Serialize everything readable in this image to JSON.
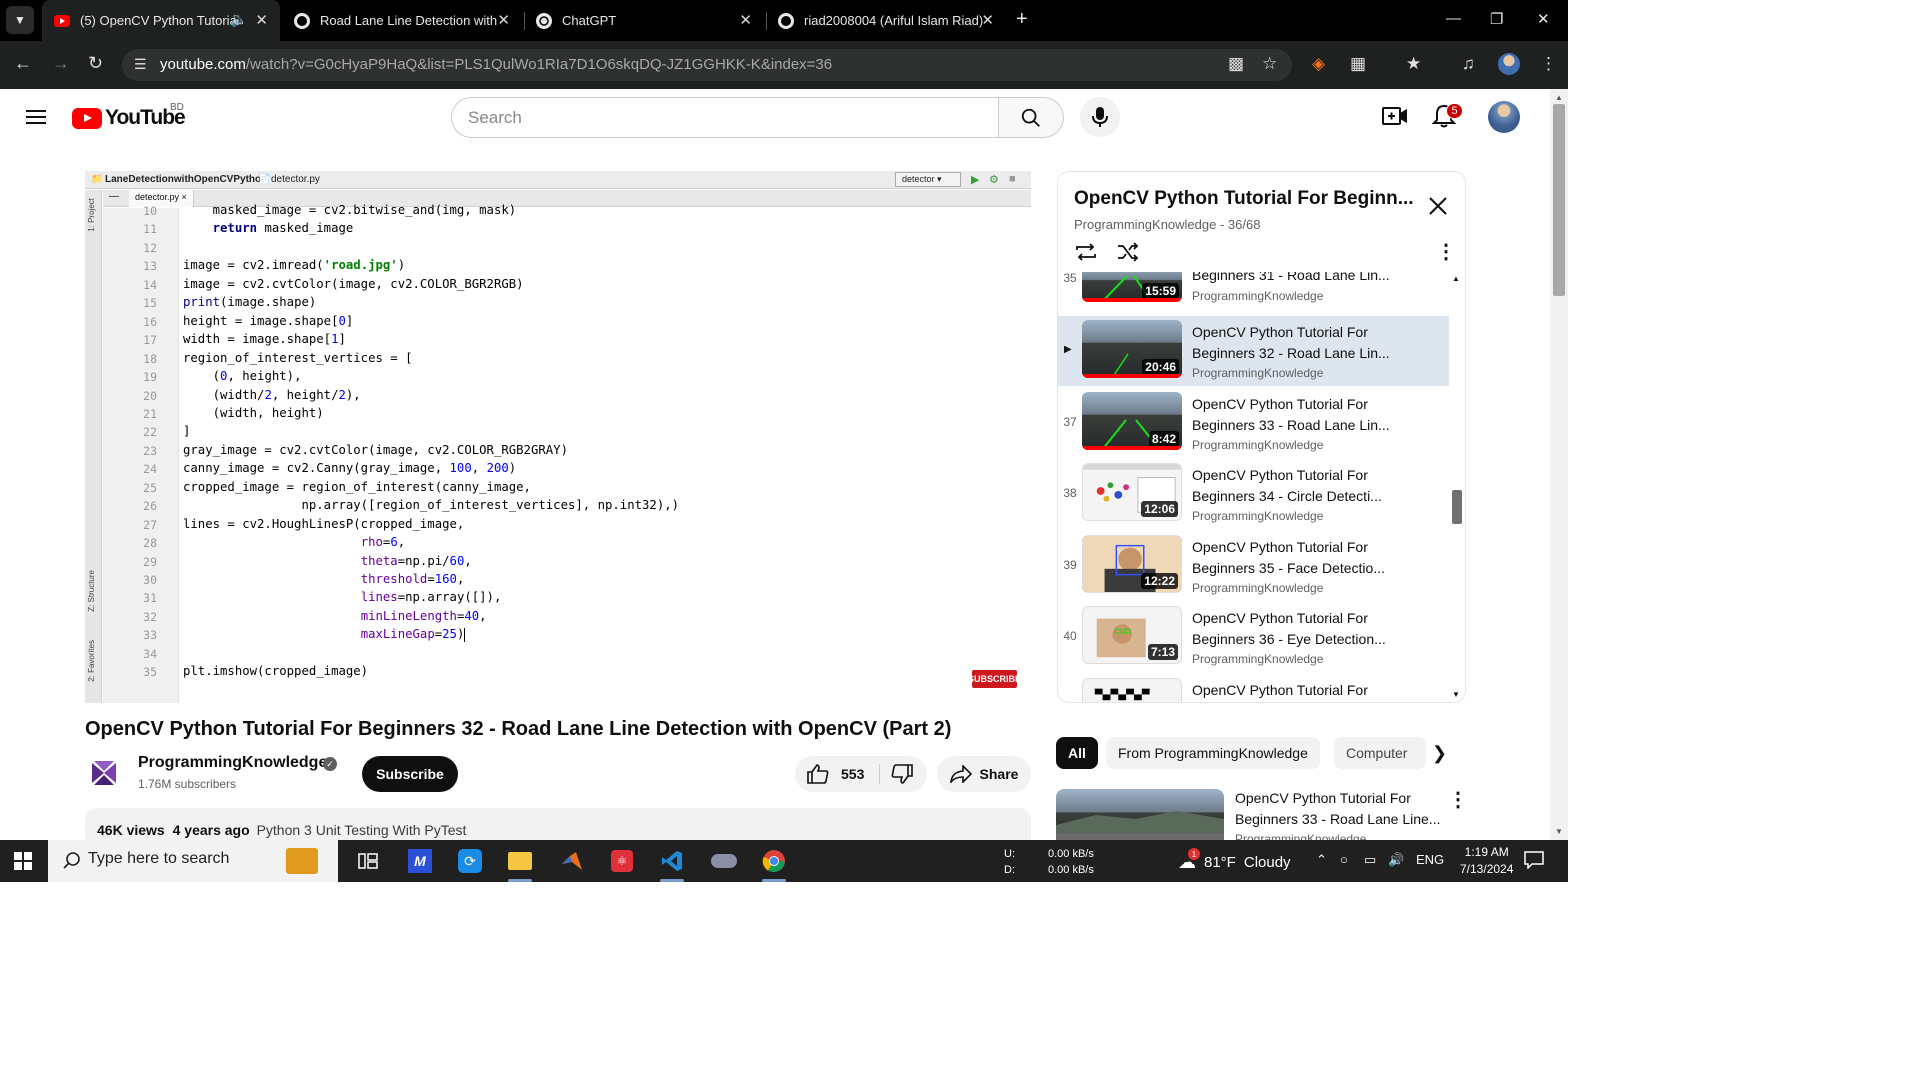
{
  "browser": {
    "tabs": [
      {
        "title": "(5) OpenCV Python Tutorial",
        "active": true,
        "icon": "youtube-icon"
      },
      {
        "title": "Road Lane Line Detection with",
        "active": false,
        "icon": "github-icon"
      },
      {
        "title": "ChatGPT",
        "active": false,
        "icon": "chatgpt-icon"
      },
      {
        "title": "riad2008004 (Ariful Islam Riad)",
        "active": false,
        "icon": "github-icon"
      }
    ],
    "url_host": "youtube.com",
    "url_path": "/watch?v=G0cHyaP9HaQ&list=PLS1QulWo1RIa7D1O6skqDQ-JZ1GGHKK-K&index=36"
  },
  "header": {
    "logo_text": "YouTube",
    "country": "BD",
    "search_placeholder": "Search",
    "notification_count": "5"
  },
  "ide": {
    "project": "LaneDetectionwithOpenCVPython",
    "file": "detector.py",
    "tab": "detector.py",
    "run_config": "detector",
    "side_project": "1: Project",
    "side_structure": "Z: Structure",
    "side_favorites": "2: Favorites",
    "watermark": "SUBSCRIBE",
    "lines": [
      {
        "n": "10",
        "code": "    masked_image = cv2.bitwise_and(img, mask)"
      },
      {
        "n": "11",
        "code": "    return masked_image"
      },
      {
        "n": "12",
        "code": ""
      },
      {
        "n": "13",
        "code": "image = cv2.imread('road.jpg')"
      },
      {
        "n": "14",
        "code": "image = cv2.cvtColor(image, cv2.COLOR_BGR2RGB)"
      },
      {
        "n": "15",
        "code": "print(image.shape)"
      },
      {
        "n": "16",
        "code": "height = image.shape[0]"
      },
      {
        "n": "17",
        "code": "width = image.shape[1]"
      },
      {
        "n": "18",
        "code": "region_of_interest_vertices = ["
      },
      {
        "n": "19",
        "code": "    (0, height),"
      },
      {
        "n": "20",
        "code": "    (width/2, height/2),"
      },
      {
        "n": "21",
        "code": "    (width, height)"
      },
      {
        "n": "22",
        "code": "]"
      },
      {
        "n": "23",
        "code": "gray_image = cv2.cvtColor(image, cv2.COLOR_RGB2GRAY)"
      },
      {
        "n": "24",
        "code": "canny_image = cv2.Canny(gray_image, 100, 200)"
      },
      {
        "n": "25",
        "code": "cropped_image = region_of_interest(canny_image,"
      },
      {
        "n": "26",
        "code": "                np.array([region_of_interest_vertices], np.int32),)"
      },
      {
        "n": "27",
        "code": "lines = cv2.HoughLinesP(cropped_image,"
      },
      {
        "n": "28",
        "code": "                        rho=6,"
      },
      {
        "n": "29",
        "code": "                        theta=np.pi/60,"
      },
      {
        "n": "30",
        "code": "                        threshold=160,"
      },
      {
        "n": "31",
        "code": "                        lines=np.array([]),"
      },
      {
        "n": "32",
        "code": "                        minLineLength=40,"
      },
      {
        "n": "33",
        "code": "                        maxLineGap=25)"
      },
      {
        "n": "34",
        "code": ""
      },
      {
        "n": "35",
        "code": "plt.imshow(cropped_image)"
      }
    ]
  },
  "video": {
    "title": "OpenCV Python Tutorial For Beginners 32 - Road Lane Line Detection with OpenCV (Part 2)",
    "channel": "ProgrammingKnowledge",
    "subscribers": "1.76M subscribers",
    "subscribe_label": "Subscribe",
    "likes": "553",
    "share_label": "Share",
    "views": "46K views",
    "age": "4 years ago",
    "description_tag": "Python 3 Unit Testing With PyTest"
  },
  "playlist": {
    "title": "OpenCV Python Tutorial For Beginn...",
    "subtitle": "ProgrammingKnowledge - 36/68",
    "items": [
      {
        "idx": "35",
        "title": "Beginners 31 - Road Lane Lin...",
        "channel": "ProgrammingKnowledge",
        "duration": "15:59",
        "current": false
      },
      {
        "idx": "",
        "title": "OpenCV Python Tutorial For Beginners 32 - Road Lane Lin...",
        "channel": "ProgrammingKnowledge",
        "duration": "20:46",
        "current": true
      },
      {
        "idx": "37",
        "title": "OpenCV Python Tutorial For Beginners 33 - Road Lane Lin...",
        "channel": "ProgrammingKnowledge",
        "duration": "8:42",
        "current": false
      },
      {
        "idx": "38",
        "title": "OpenCV Python Tutorial For Beginners 34 - Circle Detecti...",
        "channel": "ProgrammingKnowledge",
        "duration": "12:06",
        "current": false
      },
      {
        "idx": "39",
        "title": "OpenCV Python Tutorial For Beginners 35 - Face Detectio...",
        "channel": "ProgrammingKnowledge",
        "duration": "12:22",
        "current": false
      },
      {
        "idx": "40",
        "title": "OpenCV Python Tutorial For Beginners 36 - Eye Detection...",
        "channel": "ProgrammingKnowledge",
        "duration": "7:13",
        "current": false
      },
      {
        "idx": "",
        "title": "OpenCV Python Tutorial For",
        "channel": "",
        "duration": "",
        "current": false
      }
    ]
  },
  "chips": [
    "All",
    "From ProgrammingKnowledge",
    "Computer"
  ],
  "related": {
    "title": "OpenCV Python Tutorial For Beginners 33 - Road Lane Line...",
    "channel": "ProgrammingKnowledge"
  },
  "taskbar": {
    "search_placeholder": "Type here to search",
    "net_up_label": "U:",
    "net_down_label": "D:",
    "net_up": "0.00 kB/s",
    "net_down": "0.00 kB/s",
    "weather_temp": "81°F",
    "weather_desc": "Cloudy",
    "weather_badge": "1",
    "lang": "ENG",
    "time": "1:19 AM",
    "date": "7/13/2024"
  },
  "colors": {
    "youtube_red": "#ff0000",
    "playlist_current_bg": "#dde5ef",
    "taskbar_bg": "#202020",
    "browser_bg": "#000000"
  }
}
